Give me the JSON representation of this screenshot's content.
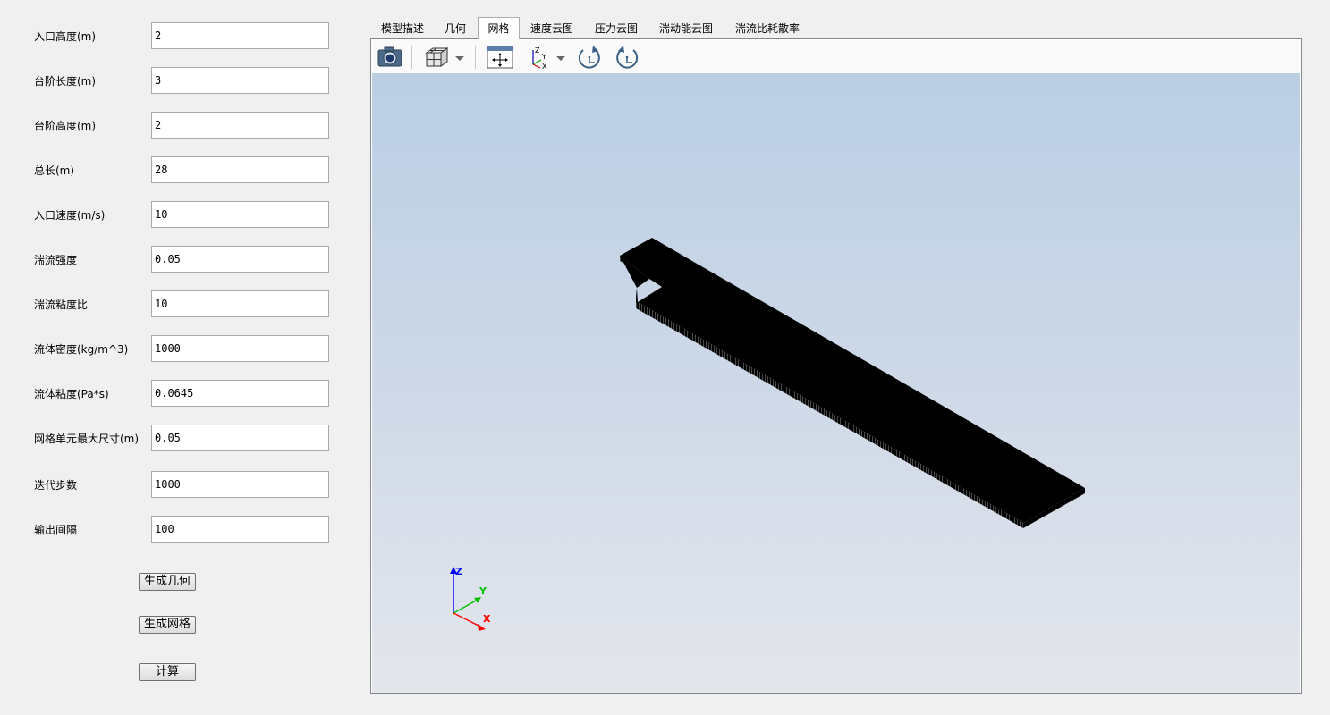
{
  "params": [
    {
      "label": "入口高度(m)",
      "value": "2"
    },
    {
      "label": "台阶长度(m)",
      "value": "3"
    },
    {
      "label": "台阶高度(m)",
      "value": "2"
    },
    {
      "label": "总长(m)",
      "value": "28"
    },
    {
      "label": "入口速度(m/s)",
      "value": "10"
    },
    {
      "label": "湍流强度",
      "value": "0.05"
    },
    {
      "label": "湍流粘度比",
      "value": "10"
    },
    {
      "label": "流体密度(kg/m^3)",
      "value": "1000"
    },
    {
      "label": "流体粘度(Pa*s)",
      "value": "0.0645"
    },
    {
      "label": "网格单元最大尺寸(m)",
      "value": "0.05"
    },
    {
      "label": "迭代步数",
      "value": "1000"
    },
    {
      "label": "输出间隔",
      "value": "100"
    }
  ],
  "buttons": {
    "generate_geometry": "生成几何",
    "generate_mesh": "生成网格",
    "compute": "计算"
  },
  "tabs": [
    "模型描述",
    "几何",
    "网格",
    "速度云图",
    "压力云图",
    "湍动能云图",
    "湍流比耗散率"
  ],
  "active_tab": "网格",
  "toolbar_icons": [
    "camera-icon",
    "cube-view-icon",
    "dropdown-arrow-icon",
    "fit-view-icon",
    "axes-orientation-icon",
    "dropdown-arrow-icon",
    "rotate-clockwise-icon",
    "rotate-counterclockwise-icon"
  ],
  "axes": {
    "x": "X",
    "y": "Y",
    "z": "Z"
  },
  "colors": {
    "axis_x": "#ff0000",
    "axis_y": "#00c000",
    "axis_z": "#0000ff",
    "mesh": "#000000"
  }
}
